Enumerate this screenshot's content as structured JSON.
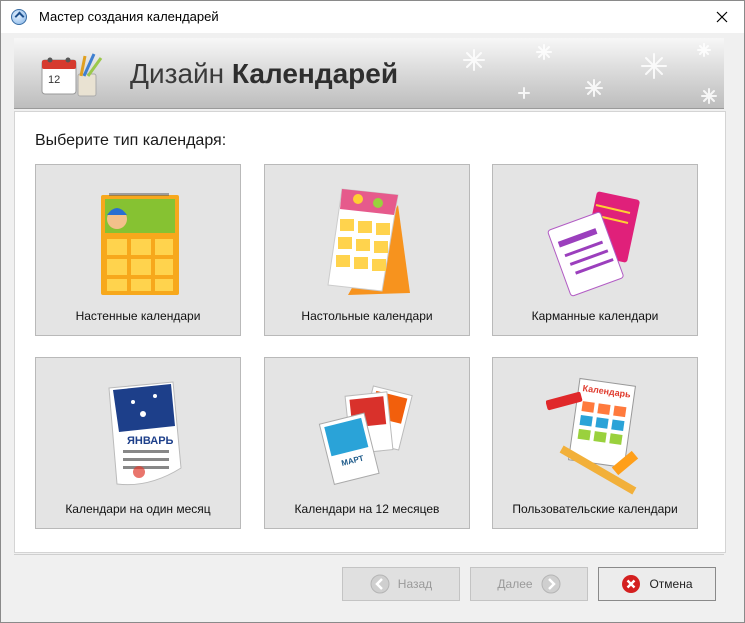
{
  "window": {
    "title": "Мастер создания календарей"
  },
  "header": {
    "title_regular": "Дизайн",
    "title_bold": "Календарей"
  },
  "content": {
    "prompt": "Выберите тип календаря:",
    "tiles": [
      {
        "label": "Настенные календари",
        "icon": "wall-calendar-icon"
      },
      {
        "label": "Настольные календари",
        "icon": "desk-calendar-icon"
      },
      {
        "label": "Карманные календари",
        "icon": "pocket-calendar-icon"
      },
      {
        "label": "Календари на один месяц",
        "icon": "one-month-calendar-icon",
        "pic_text": "ЯНВАРЬ"
      },
      {
        "label": "Календари на 12 месяцев",
        "icon": "twelve-month-calendar-icon",
        "pic_text": "МАРТ"
      },
      {
        "label": "Пользовательские календари",
        "icon": "custom-calendar-icon",
        "pic_text": "Календарь"
      }
    ]
  },
  "footer": {
    "back_label": "Назад",
    "next_label": "Далее",
    "cancel_label": "Отмена"
  },
  "colors": {
    "header_gradient_top": "#f7f7f7",
    "header_gradient_bottom": "#bdbdbd",
    "tile_bg": "#e4e4e4",
    "cancel_icon": "#d42020"
  }
}
